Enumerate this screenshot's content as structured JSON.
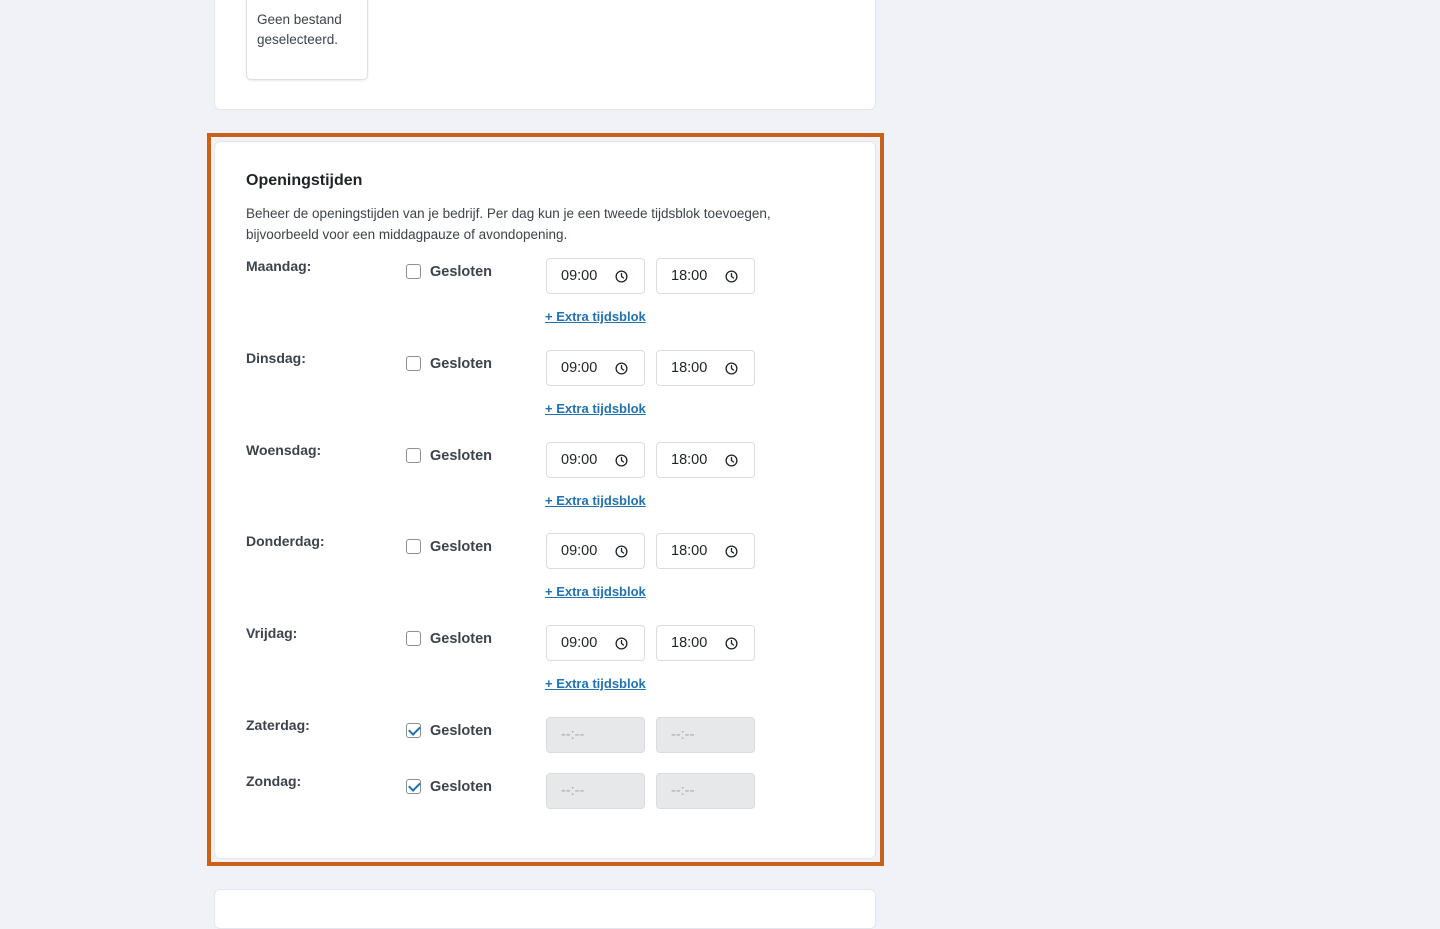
{
  "file_upload": {
    "status_text": "Geen bestand geselecteerd."
  },
  "opening_hours": {
    "title": "Openingstijden",
    "description": "Beheer de openingstijden van je bedrijf. Per dag kun je een tweede tijdsblok toevoegen, bijvoorbeeld voor een middagpauze of avondopening.",
    "closed_label": "Gesloten",
    "extra_block_label": "+ Extra tijdsblok",
    "days": [
      {
        "label": "Maandag:",
        "closed": false,
        "open": "09:00",
        "close": "18:00"
      },
      {
        "label": "Dinsdag:",
        "closed": false,
        "open": "09:00",
        "close": "18:00"
      },
      {
        "label": "Woensdag:",
        "closed": false,
        "open": "09:00",
        "close": "18:00"
      },
      {
        "label": "Donderdag:",
        "closed": false,
        "open": "09:00",
        "close": "18:00"
      },
      {
        "label": "Vrijdag:",
        "closed": false,
        "open": "09:00",
        "close": "18:00"
      },
      {
        "label": "Zaterdag:",
        "closed": true,
        "open": "--:--",
        "close": "--:--"
      },
      {
        "label": "Zondag:",
        "closed": true,
        "open": "--:--",
        "close": "--:--"
      }
    ]
  },
  "colors": {
    "accent_link": "#2271b1",
    "highlight_border": "#c8621a",
    "page_background": "#f0f2f7"
  }
}
